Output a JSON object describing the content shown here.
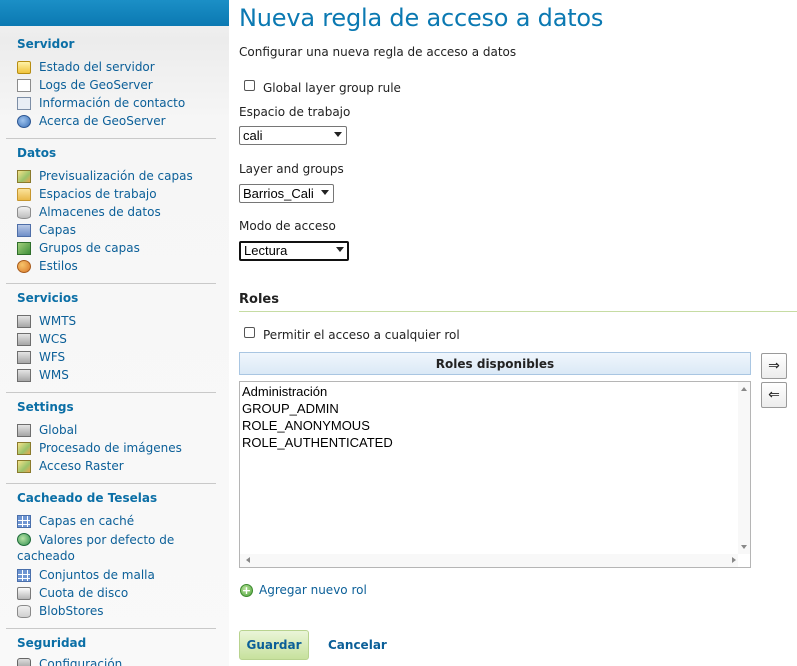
{
  "sidebar": {
    "sections": [
      {
        "heading": "Servidor",
        "items": [
          {
            "label": "Estado del servidor",
            "icon": "warning-icon"
          },
          {
            "label": "Logs de GeoServer",
            "icon": "document-icon"
          },
          {
            "label": "Información de contacto",
            "icon": "contact-card-icon"
          },
          {
            "label": "Acerca de GeoServer",
            "icon": "help-icon"
          }
        ]
      },
      {
        "heading": "Datos",
        "items": [
          {
            "label": "Previsualización de capas",
            "icon": "map-preview-icon"
          },
          {
            "label": "Espacios de trabajo",
            "icon": "folder-icon"
          },
          {
            "label": "Almacenes de datos",
            "icon": "database-icon"
          },
          {
            "label": "Capas",
            "icon": "layer-icon"
          },
          {
            "label": "Grupos de capas",
            "icon": "layer-group-icon"
          },
          {
            "label": "Estilos",
            "icon": "palette-icon"
          }
        ]
      },
      {
        "heading": "Servicios",
        "items": [
          {
            "label": "WMTS",
            "icon": "service-icon"
          },
          {
            "label": "WCS",
            "icon": "service-icon"
          },
          {
            "label": "WFS",
            "icon": "service-icon"
          },
          {
            "label": "WMS",
            "icon": "service-icon"
          }
        ]
      },
      {
        "heading": "Settings",
        "items": [
          {
            "label": "Global",
            "icon": "server-icon"
          },
          {
            "label": "Procesado de imágenes",
            "icon": "image-processing-icon"
          },
          {
            "label": "Acceso Raster",
            "icon": "raster-icon"
          }
        ]
      },
      {
        "heading": "Cacheado de Teselas",
        "items": [
          {
            "label": "Capas en caché",
            "icon": "tile-grid-icon"
          },
          {
            "label": "Valores por defecto de",
            "label_cont": "cacheado",
            "icon": "globe-icon"
          },
          {
            "label": "Conjuntos de malla",
            "icon": "tile-grid-icon"
          },
          {
            "label": "Cuota de disco",
            "icon": "disk-icon"
          },
          {
            "label": "BlobStores",
            "icon": "blobstore-icon"
          }
        ]
      },
      {
        "heading": "Seguridad",
        "items": [
          {
            "label": "Configuración",
            "icon": "key-icon"
          }
        ]
      }
    ]
  },
  "main": {
    "title": "Nueva regla de acceso a datos",
    "description": "Configurar una nueva regla de acceso a datos",
    "global_group_rule": {
      "label": "Global layer group rule",
      "checked": false
    },
    "workspace": {
      "label": "Espacio de trabajo",
      "value": "cali"
    },
    "layer": {
      "label": "Layer and groups",
      "value": "Barrios_Cali"
    },
    "access_mode": {
      "label": "Modo de acceso",
      "value": "Lectura"
    },
    "roles": {
      "heading": "Roles",
      "any_role": {
        "label": "Permitir el acceso a cualquier rol",
        "checked": false
      },
      "available_header": "Roles disponibles",
      "available": [
        "Administración",
        "GROUP_ADMIN",
        "ROLE_ANONYMOUS",
        "ROLE_AUTHENTICATED"
      ],
      "add_button": "⇒",
      "remove_button": "⇐",
      "add_new": "Agregar nuevo rol"
    },
    "save_label": "Guardar",
    "cancel_label": "Cancelar"
  },
  "colors": {
    "accent_blue": "#0b79b2",
    "link": "#0b5f98",
    "save_bg": "#c7e19d"
  }
}
